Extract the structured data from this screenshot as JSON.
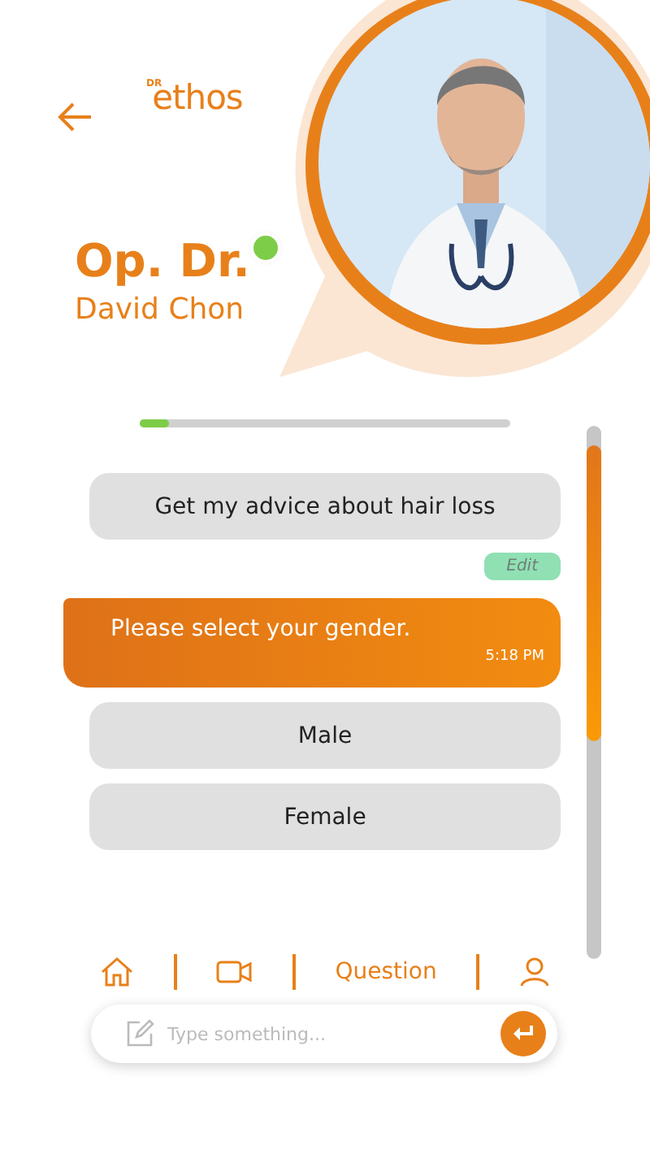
{
  "header": {
    "logo_small": "DR",
    "logo": "ethos",
    "title": "Op. Dr.",
    "name": "David Chon",
    "online": true
  },
  "progress": {
    "level": 0.08
  },
  "messages": [
    {
      "kind": "user",
      "text": "Get my advice about hair loss",
      "edit": "Edit"
    },
    {
      "kind": "bot",
      "text": "Please select your gender.",
      "time": "5:18 PM"
    },
    {
      "kind": "option",
      "text": "Male"
    },
    {
      "kind": "option",
      "text": "Female"
    }
  ],
  "nav": [
    {
      "kind": "home"
    },
    {
      "kind": "video"
    },
    {
      "kind": "text",
      "label": "Question"
    },
    {
      "kind": "profile"
    }
  ],
  "composer": {
    "placeholder": "Type something..."
  }
}
